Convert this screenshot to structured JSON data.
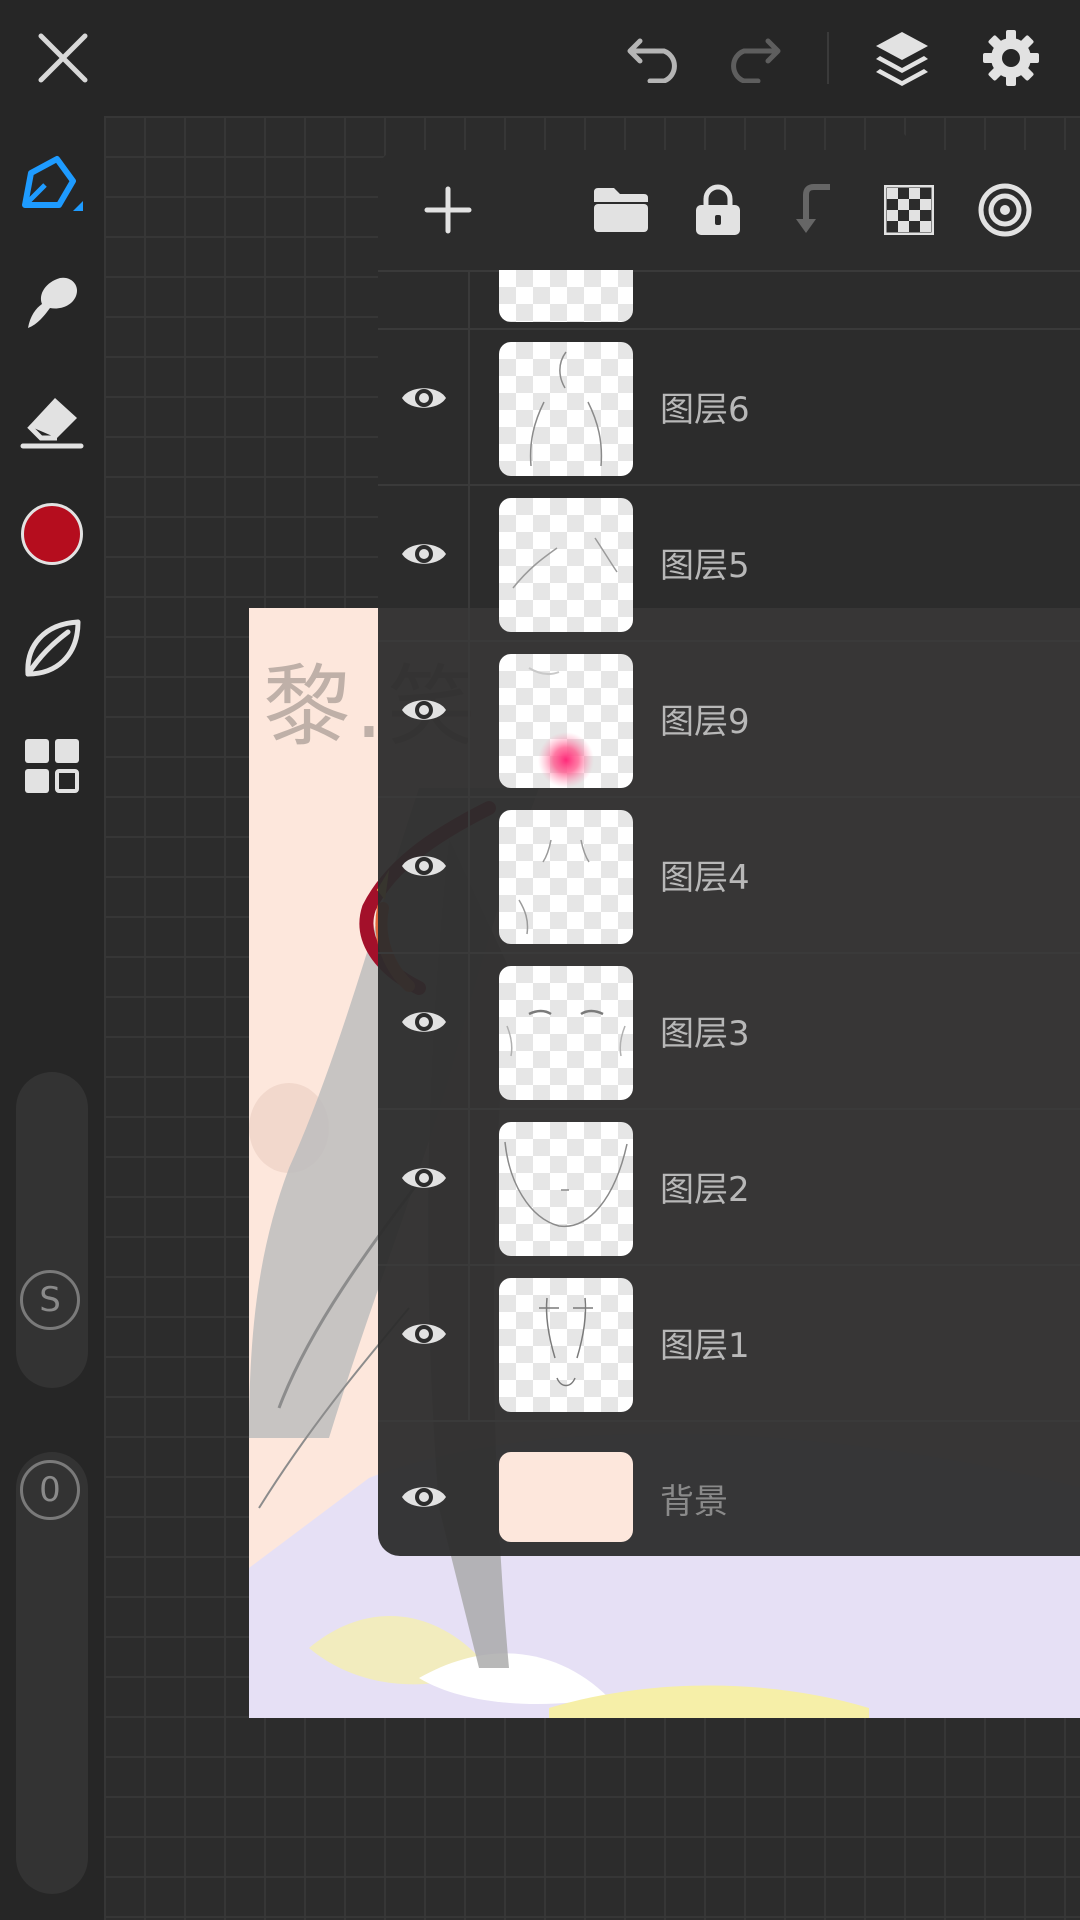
{
  "toolbar": {
    "close_icon": "close-icon",
    "undo_icon": "undo-icon",
    "redo_icon": "redo-icon",
    "layers_icon": "layers-icon",
    "settings_icon": "gear-icon"
  },
  "tools": {
    "active_color": "#b50d1e",
    "accent_color": "#1e9bff",
    "size_slider_label": "S",
    "opacity_slider_label": "0"
  },
  "canvas": {
    "watermark": "黎.笑",
    "background_color": "#fde7dc"
  },
  "layers_panel": {
    "header_icons": [
      "add-icon",
      "folder-icon",
      "lock-icon",
      "merge-down-icon",
      "transparency-icon",
      "layer-target-icon"
    ],
    "layers": [
      {
        "name": "图层6",
        "visible": true
      },
      {
        "name": "图层5",
        "visible": true
      },
      {
        "name": "图层9",
        "visible": true
      },
      {
        "name": "图层4",
        "visible": true
      },
      {
        "name": "图层3",
        "visible": true
      },
      {
        "name": "图层2",
        "visible": true
      },
      {
        "name": "图层1",
        "visible": true
      }
    ],
    "background_layer": {
      "name": "背景",
      "visible": true,
      "color": "#fde7dc"
    }
  }
}
